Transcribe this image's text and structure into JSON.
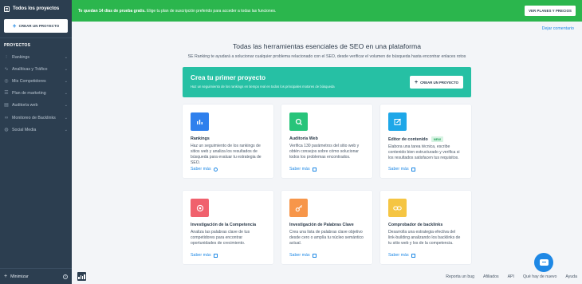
{
  "sidebar": {
    "all_projects": "Todos los proyectos",
    "create_project": "CREAR UN PROYECTO",
    "section": "PROYECTOS",
    "items": [
      {
        "label": "Rankings",
        "icon": "rankings-icon"
      },
      {
        "label": "Analíticas y Tráfico",
        "icon": "analytics-icon"
      },
      {
        "label": "Mis Competidores",
        "icon": "competitors-icon"
      },
      {
        "label": "Plan de marketing",
        "icon": "marketing-plan-icon"
      },
      {
        "label": "Auditoría web",
        "icon": "audit-icon"
      },
      {
        "label": "Monitoreo de Backlinks",
        "icon": "backlinks-icon"
      },
      {
        "label": "Social Media",
        "icon": "social-icon"
      }
    ],
    "minimize": "Minimizar"
  },
  "banner": {
    "bold": "Te quedan 14 días de prueba gratis.",
    "text": " Elige tu plan de suscripción preferido para acceder a todas las funciones.",
    "button": "VER PLANES Y PRECIOS"
  },
  "dismiss": "Dejar comentario",
  "main": {
    "title": "Todas las herramientas esenciales de SEO en una plataforma",
    "subtitle": "SE Ranking te ayudará a solucionar cualquier problema relacionado con el SEO, desde verificar el volumen de búsqueda hasta encontrar enlaces rotos"
  },
  "hero": {
    "title": "Crea tu primer proyecto",
    "desc": "Haz un seguimiento de los rankings en tiempo real en todos los principales motores de búsqueda",
    "button": "CREAR UN PROYECTO"
  },
  "cards": [
    {
      "title": "Rankings",
      "badge": "",
      "desc": "Haz un seguimiento de los rankings de sitios web y analiza los resultados de búsqueda para evaluar tu estrategia de SEO.",
      "more": "Saber más",
      "color": "#2f80ed",
      "icon": "bar-chart-icon"
    },
    {
      "title": "Auditoría Web",
      "badge": "",
      "desc": "Verifica 130 parámetros del sitio web y obtén consejos sobre cómo solucionar todos los problemas encontrados.",
      "more": "Saber más",
      "color": "#27c47a",
      "icon": "magnifier-icon"
    },
    {
      "title": "Editor de contenido",
      "badge": "NEW",
      "desc": "Elabora una tarea técnica, escribe contenido bien estructurado y verifica si los resultados satisfacen tus requisitos.",
      "more": "Saber más",
      "color": "#1ea7e8",
      "icon": "edit-icon"
    },
    {
      "title": "Investigación de la Competencia",
      "badge": "",
      "desc": "Analiza las palabras clave de tus competidores para encontrar oportunidades de crecimiento.",
      "more": "Saber más",
      "color": "#f0616d",
      "icon": "target-icon"
    },
    {
      "title": "Investigación de Palabras Clave",
      "badge": "",
      "desc": "Crea una lista de palabras clave objetivo desde cero o amplía tu núcleo semántico actual.",
      "more": "Saber más",
      "color": "#f7964a",
      "icon": "key-icon"
    },
    {
      "title": "Comprobador de backlinks",
      "badge": "",
      "desc": "Desarrolla una estrategia efectiva del link-building analizando los backlinks de tu sitio web y los de la competencia.",
      "more": "Saber más",
      "color": "#f5c543",
      "icon": "link-icon"
    }
  ],
  "footer": [
    "Reporta un bug",
    "Afiliados",
    "API",
    "Qué hay de nuevo",
    "Ayuda"
  ]
}
